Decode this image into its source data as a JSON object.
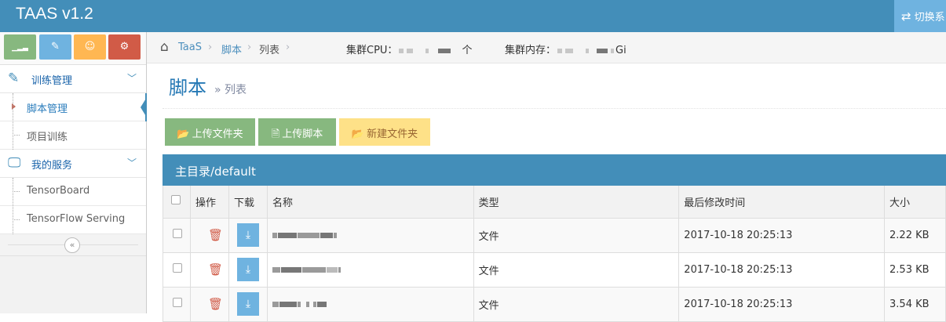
{
  "app": {
    "brand": "TAAS v1.2",
    "switch_label": "切换系",
    "switch_icon": "exchange-icon"
  },
  "shortcuts": [
    {
      "icon": "signal-icon",
      "glyph": "▁▂▃",
      "color": "#87b87f"
    },
    {
      "icon": "pencil-icon",
      "glyph": "✎",
      "color": "#6fb3e0"
    },
    {
      "icon": "users-icon",
      "glyph": "☺",
      "color": "#ffb752"
    },
    {
      "icon": "cogs-icon",
      "glyph": "⚙",
      "color": "#d15b47"
    }
  ],
  "sidebar": {
    "menus": [
      {
        "label": "训练管理",
        "icon": "edit-icon"
      },
      {
        "label": "我的服务",
        "icon": "desktop-icon"
      }
    ],
    "training_items": [
      {
        "label": "脚本管理"
      },
      {
        "label": "项目训练"
      }
    ],
    "service_items": [
      {
        "label": "TensorBoard"
      },
      {
        "label": "TensorFlow Serving"
      }
    ],
    "collapse_icon": "double-angle-left-icon"
  },
  "breadcrumb": {
    "home_icon": "home-icon",
    "items": [
      "TaaS",
      "脚本",
      "列表"
    ],
    "cpu_label": "集群CPU：",
    "cpu_unit": "个",
    "mem_label": "集群内存：",
    "mem_unit": "Gi"
  },
  "page": {
    "title": "脚本",
    "subtitle": "» 列表"
  },
  "actions": {
    "upload_folder": "上传文件夹",
    "upload_script": "上传脚本",
    "new_folder": "新建文件夹"
  },
  "table": {
    "path": "主目录/default",
    "columns": [
      "操作",
      "下载",
      "名称",
      "类型",
      "最后修改时间",
      "大小"
    ],
    "rows": [
      {
        "type": "文件",
        "modified": "2017-10-18 20:25:13",
        "size": "2.22 KB"
      },
      {
        "type": "文件",
        "modified": "2017-10-18 20:25:13",
        "size": "2.53 KB"
      },
      {
        "type": "文件",
        "modified": "2017-10-18 20:25:13",
        "size": "3.54 KB"
      }
    ]
  },
  "colors": {
    "navbar": "#438eb9",
    "success": "#87b87f",
    "warning": "#fee188",
    "danger": "#d15b47",
    "info": "#6fb3e0"
  }
}
